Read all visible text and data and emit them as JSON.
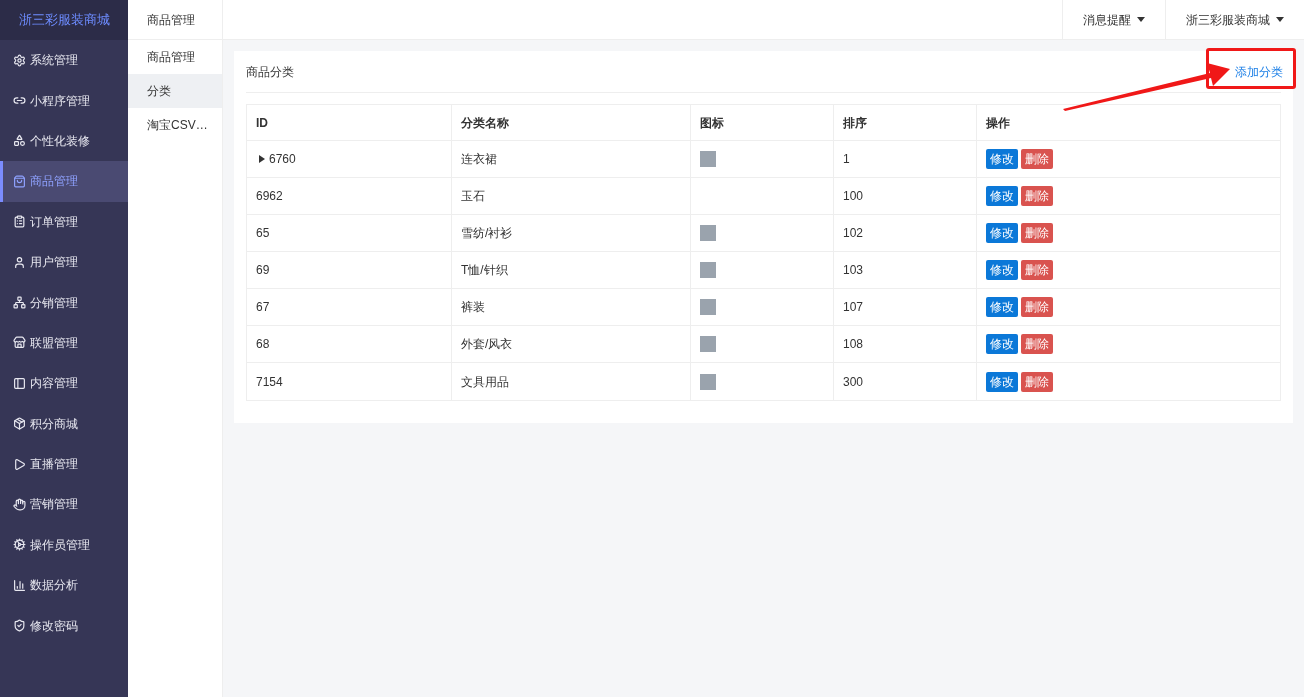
{
  "brand": "浙三彩服装商城",
  "sidebar": {
    "items": [
      {
        "label": "系统管理",
        "selected": false
      },
      {
        "label": "小程序管理",
        "selected": false
      },
      {
        "label": "个性化装修",
        "selected": false
      },
      {
        "label": "商品管理",
        "selected": true
      },
      {
        "label": "订单管理",
        "selected": false
      },
      {
        "label": "用户管理",
        "selected": false
      },
      {
        "label": "分销管理",
        "selected": false
      },
      {
        "label": "联盟管理",
        "selected": false
      },
      {
        "label": "内容管理",
        "selected": false
      },
      {
        "label": "积分商城",
        "selected": false
      },
      {
        "label": "直播管理",
        "selected": false
      },
      {
        "label": "营销管理",
        "selected": false
      },
      {
        "label": "操作员管理",
        "selected": false
      },
      {
        "label": "数据分析",
        "selected": false
      },
      {
        "label": "修改密码",
        "selected": false
      }
    ]
  },
  "subnav": {
    "title": "商品管理",
    "items": [
      {
        "label": "商品管理",
        "selected": false
      },
      {
        "label": "分类",
        "selected": true
      },
      {
        "label": "淘宝CSV…",
        "selected": false
      }
    ]
  },
  "topbar": {
    "menus": [
      "消息提醒",
      "浙三彩服装商城"
    ]
  },
  "card": {
    "title": "商品分类",
    "add_link": "添加分类",
    "annotation": true
  },
  "table": {
    "columns": [
      "ID",
      "分类名称",
      "图标",
      "排序",
      "操作"
    ],
    "rows": [
      {
        "id": "6760",
        "expandable": true,
        "name": "连衣裙",
        "has_icon": true,
        "sort": "1",
        "actions": [
          "修改",
          "删除"
        ]
      },
      {
        "id": "6962",
        "expandable": false,
        "name": "玉石",
        "has_icon": false,
        "sort": "100",
        "actions": [
          "修改",
          "删除"
        ]
      },
      {
        "id": "65",
        "expandable": false,
        "name": "雪纺/衬衫",
        "has_icon": true,
        "sort": "102",
        "actions": [
          "修改",
          "删除"
        ]
      },
      {
        "id": "69",
        "expandable": false,
        "name": "T恤/针织",
        "has_icon": true,
        "sort": "103",
        "actions": [
          "修改",
          "删除"
        ]
      },
      {
        "id": "67",
        "expandable": false,
        "name": "裤装",
        "has_icon": true,
        "sort": "107",
        "actions": [
          "修改",
          "删除"
        ]
      },
      {
        "id": "68",
        "expandable": false,
        "name": "外套/风衣",
        "has_icon": true,
        "sort": "108",
        "actions": [
          "修改",
          "删除"
        ]
      },
      {
        "id": "7154",
        "expandable": false,
        "name": "文具用品",
        "has_icon": true,
        "sort": "300",
        "actions": [
          "修改",
          "删除"
        ]
      }
    ]
  }
}
